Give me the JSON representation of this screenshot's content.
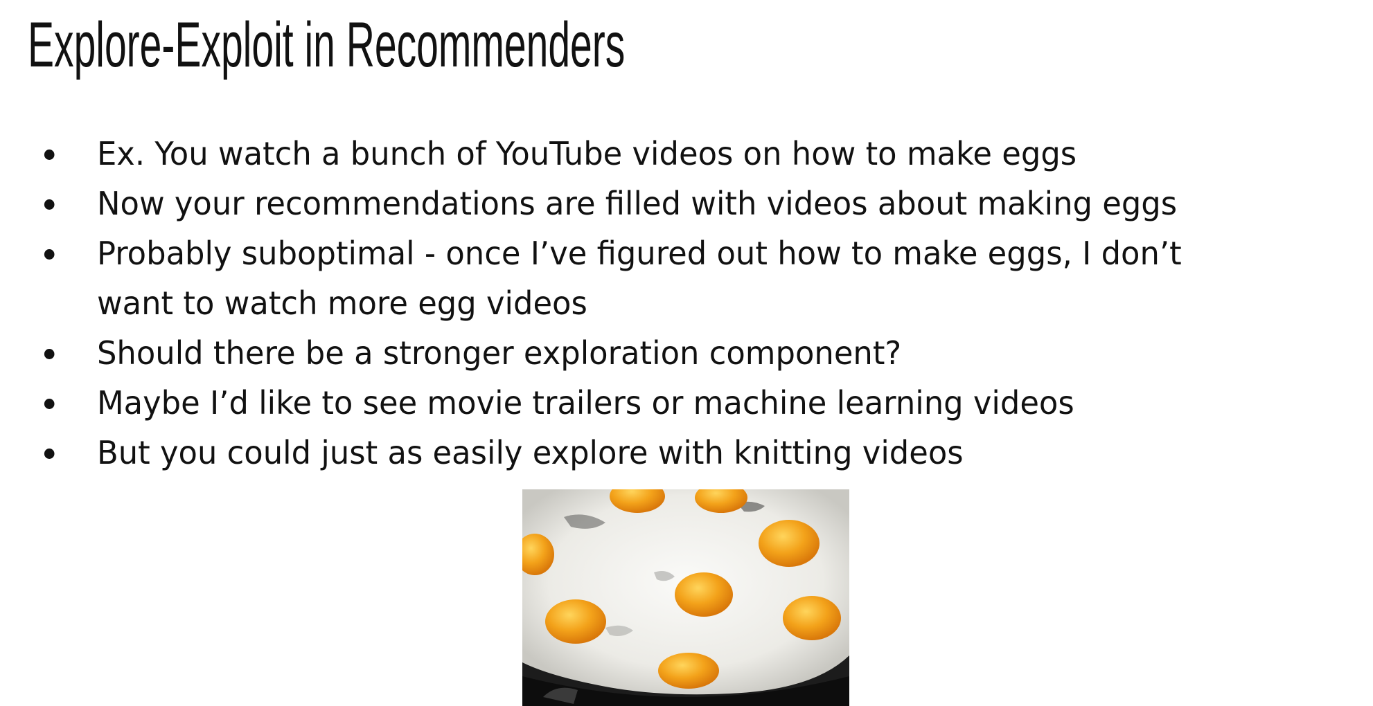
{
  "slide": {
    "title": "Explore-Exploit in Recommenders",
    "bullets": [
      {
        "lines": [
          "Ex. You watch a bunch of YouTube videos on how to make eggs"
        ]
      },
      {
        "lines": [
          "Now your recommendations are filled with videos about making eggs"
        ]
      },
      {
        "lines": [
          "Probably suboptimal - once I’ve figured out how to make eggs, I don’t",
          "want to watch more egg videos"
        ]
      },
      {
        "lines": [
          "Should there be a stronger exploration component?"
        ]
      },
      {
        "lines": [
          "Maybe I’d like to see movie trailers or machine learning videos"
        ]
      },
      {
        "lines": [
          "But you could just as easily explore with knitting videos"
        ]
      }
    ],
    "image": {
      "icon": "fried-eggs-photo",
      "colors": {
        "pan": "#1c1c1c",
        "egg_white": "#f2f2ee",
        "yolk": "#f3a21a",
        "yolk_highlight": "#ffd55c"
      }
    }
  }
}
